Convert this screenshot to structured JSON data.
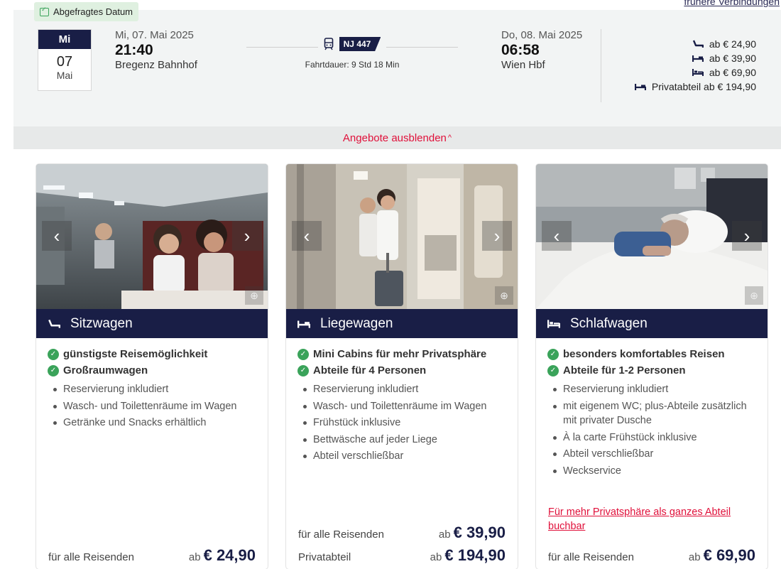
{
  "header": {
    "earlier_connections": "frühere Verbindungen"
  },
  "connection": {
    "date_tag": "Abgefragtes Datum",
    "day": {
      "weekday": "Mi",
      "number": "07",
      "month": "Mai"
    },
    "departure": {
      "date": "Mi, 07. Mai 2025",
      "time": "21:40",
      "station": "Bregenz Bahnhof"
    },
    "train": {
      "number": "NJ 447",
      "duration": "Fahrtdauer: 9 Std 18 Min"
    },
    "arrival": {
      "date": "Do, 08. Mai 2025",
      "time": "06:58",
      "station": "Wien Hbf"
    },
    "prices": [
      {
        "icon": "seat-icon",
        "text": "ab € 24,90"
      },
      {
        "icon": "couchette-icon",
        "text": "ab € 39,90"
      },
      {
        "icon": "sleeper-icon",
        "text": "ab € 69,90"
      },
      {
        "icon": "couchette-icon",
        "text": "Privatabteil ab € 194,90"
      }
    ],
    "toggle_offers": "Angebote ausblenden"
  },
  "offers": [
    {
      "title": "Sitzwagen",
      "icon": "seat-icon",
      "features": [
        "günstigste Reisemöglichkeit",
        "Großraumwagen"
      ],
      "bullets": [
        "Reservierung inkludiert",
        "Wasch- und Toilettenräume im Wagen",
        "Getränke und Snacks erhältlich"
      ],
      "prices": [
        {
          "label": "für alle Reisenden",
          "ab": "ab",
          "amount": "€ 24,90"
        }
      ]
    },
    {
      "title": "Liegewagen",
      "icon": "couchette-icon",
      "features": [
        "Mini Cabins für mehr Privatsphäre",
        "Abteile für 4 Personen"
      ],
      "bullets": [
        "Reservierung inkludiert",
        "Wasch- und Toilettenräume im Wagen",
        "Frühstück inklusive",
        "Bettwäsche auf jeder Liege",
        "Abteil verschließbar"
      ],
      "prices": [
        {
          "label": "für alle Reisenden",
          "ab": "ab",
          "amount": "€ 39,90"
        },
        {
          "label": "Privatabteil",
          "ab": "ab",
          "amount": "€ 194,90"
        }
      ]
    },
    {
      "title": "Schlafwagen",
      "icon": "sleeper-icon",
      "features": [
        "besonders komfortables Reisen",
        "Abteile für 1-2 Personen"
      ],
      "bullets": [
        "Reservierung inkludiert",
        "mit eigenem WC; plus-Abteile zusätzlich mit privater Dusche",
        "À la carte Frühstück inklusive",
        "Abteil verschließbar",
        "Weckservice"
      ],
      "link": "Für mehr Privatsphäre als ganzes Abteil buchbar",
      "prices": [
        {
          "label": "für alle Reisenden",
          "ab": "ab",
          "amount": "€ 69,90"
        }
      ]
    }
  ],
  "colors": {
    "navy": "#191e46",
    "accent_red": "#e0103a",
    "check_green": "#3aa35a"
  }
}
